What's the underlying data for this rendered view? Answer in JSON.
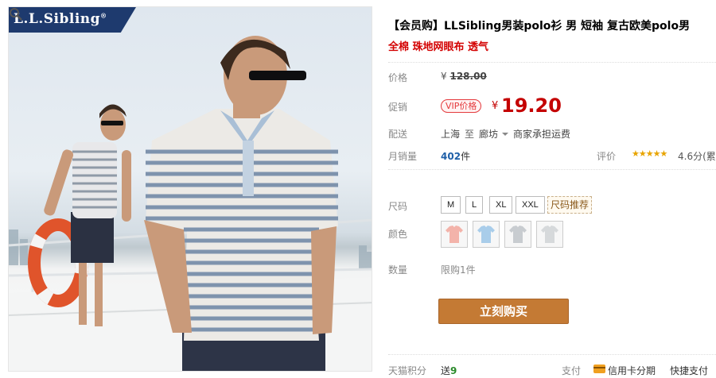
{
  "brand": {
    "name": "L.L.Sibling",
    "registered": "®"
  },
  "product": {
    "title": "【会员购】LLSibling男装polo衫 男 短袖 复古欧美polo男",
    "subtitle": "全棉 珠地网眼布 透气"
  },
  "price": {
    "label": "价格",
    "currency": "¥",
    "original": "128.00",
    "promo_label": "促销",
    "vip_tag": "VIP价格",
    "sale": "19.20"
  },
  "shipping": {
    "label": "配送",
    "from": "上海",
    "to_word": "至",
    "to": "廊坊",
    "fee_note": "商家承担运费"
  },
  "sales": {
    "label": "月销量",
    "count": "402",
    "unit": "件",
    "rating_label": "评价",
    "stars": "★★★★★",
    "score": "4.6分(累"
  },
  "size": {
    "label": "尺码",
    "options": [
      "M",
      "L",
      "XL",
      "XXL"
    ],
    "recommend": "尺码推荐"
  },
  "color": {
    "label": "颜色",
    "swatches": [
      {
        "name": "pink",
        "color": "#f3b3aa"
      },
      {
        "name": "light-blue",
        "color": "#a9cdea"
      },
      {
        "name": "gray",
        "color": "#c8ccd0"
      },
      {
        "name": "light-gray",
        "color": "#d6d9db"
      }
    ]
  },
  "quantity": {
    "label": "数量",
    "limit": "限购1件"
  },
  "buy_button": "立刻购买",
  "footer": {
    "points_label": "天猫积分",
    "points_prefix": "送",
    "points_value": "9",
    "pay_label": "支付",
    "credit": "信用卡分期",
    "express": "快捷支付"
  },
  "colors": {
    "price_red": "#c40000",
    "title_red": "#d30000",
    "buy_button": "#c47a34",
    "brand_bar": "#1e3a6e",
    "sales_blue": "#1e5fa8"
  }
}
